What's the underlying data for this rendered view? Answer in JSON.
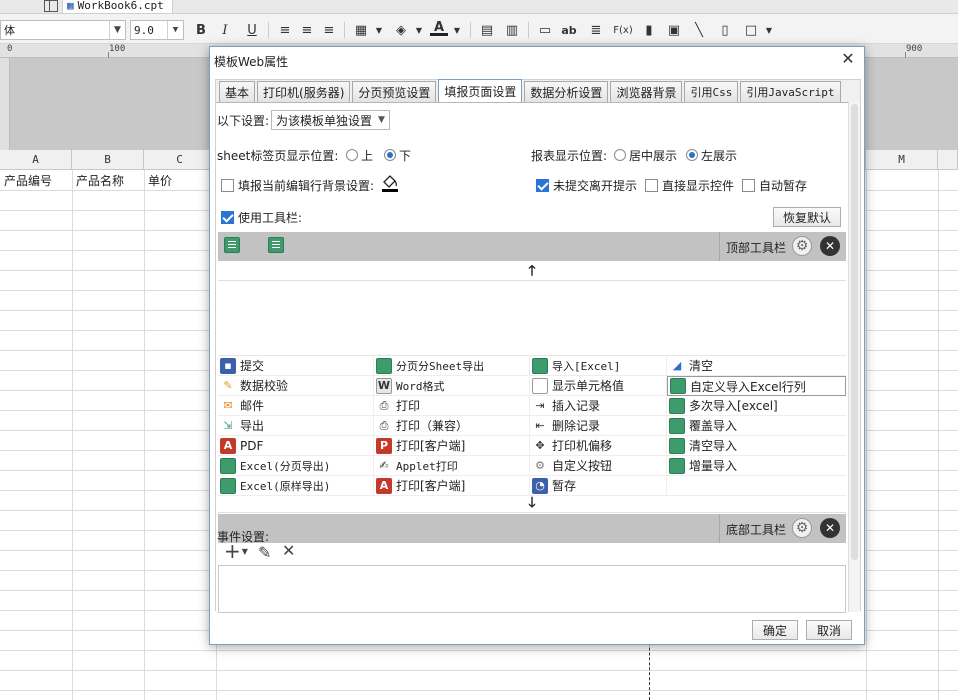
{
  "app": {
    "tab": {
      "file_name": "WorkBook6.cpt"
    },
    "toolbar": {
      "font_name": "体",
      "font_size": "9.0",
      "bold": "B",
      "italic": "I",
      "underline": "U",
      "text_icon": "ab",
      "formula_icon": "F(x)"
    },
    "ruler": {
      "marks": [
        "0",
        "100",
        "900"
      ]
    },
    "sheet": {
      "columns": [
        "A",
        "B",
        "C",
        "M"
      ],
      "header_row": [
        "产品编号",
        "产品名称",
        "单价"
      ]
    }
  },
  "dialog": {
    "title": "模板Web属性",
    "tabs": [
      {
        "label": "基本"
      },
      {
        "label": "打印机(服务器)"
      },
      {
        "label": "分页预览设置"
      },
      {
        "label": "填报页面设置"
      },
      {
        "label": "数据分析设置"
      },
      {
        "label": "浏览器背景"
      },
      {
        "label": "引用Css"
      },
      {
        "label": "引用JavaScript"
      }
    ],
    "active_tab": "填报页面设置",
    "settings": {
      "scope_label": "以下设置:",
      "scope_value": "为该模板单独设置",
      "sheet_pos_label": "sheet标签页显示位置:",
      "sheet_pos_top": "上",
      "sheet_pos_bottom": "下",
      "report_pos_label": "报表显示位置:",
      "report_pos_center": "居中展示",
      "report_pos_left": "左展示",
      "fill_bg_label": "填报当前编辑行背景设置:",
      "unsubmitted_label": "未提交离开提示",
      "direct_control_label": "直接显示控件",
      "auto_save_label": "自动暂存",
      "use_toolbar_label": "使用工具栏:",
      "restore_default": "恢复默认"
    },
    "top_toolbar_label": "顶部工具栏",
    "bottom_toolbar_label": "底部工具栏",
    "buttons": [
      [
        {
          "label": "提交",
          "icon": "save-icon"
        },
        {
          "label": "分页分Sheet导出",
          "icon": "excel-icon"
        },
        {
          "label": "导入[Excel]",
          "icon": "excel-icon"
        },
        {
          "label": "清空",
          "icon": "eraser-icon"
        }
      ],
      [
        {
          "label": "数据校验",
          "icon": "pencil-icon"
        },
        {
          "label": "Word格式",
          "icon": "word-icon"
        },
        {
          "label": "显示单元格值",
          "icon": "cell-icon"
        },
        {
          "label": "自定义导入Excel行列",
          "icon": "excel-icon"
        }
      ],
      [
        {
          "label": "邮件",
          "icon": "mail-icon"
        },
        {
          "label": "打印",
          "icon": "printer-icon"
        },
        {
          "label": "插入记录",
          "icon": "insert-row-icon"
        },
        {
          "label": "多次导入[excel]",
          "icon": "excel-icon"
        }
      ],
      [
        {
          "label": "导出",
          "icon": "export-icon"
        },
        {
          "label": "打印（兼容）",
          "icon": "printer-icon"
        },
        {
          "label": "删除记录",
          "icon": "delete-row-icon"
        },
        {
          "label": "覆盖导入",
          "icon": "excel-icon"
        }
      ],
      [
        {
          "label": "PDF",
          "icon": "pdf-icon"
        },
        {
          "label": "打印[客户端]",
          "icon": "pdf-print-icon"
        },
        {
          "label": "打印机偏移",
          "icon": "move-icon"
        },
        {
          "label": "清空导入",
          "icon": "excel-icon"
        }
      ],
      [
        {
          "label": "Excel(分页导出)",
          "icon": "excel-icon"
        },
        {
          "label": "Applet打印",
          "icon": "applet-icon"
        },
        {
          "label": "自定义按钮",
          "icon": "gear-icon"
        },
        {
          "label": "增量导入",
          "icon": "excel-icon"
        }
      ],
      [
        {
          "label": "Excel(原样导出)",
          "icon": "excel-icon"
        },
        {
          "label": "打印[客户端]",
          "icon": "pdf-icon"
        },
        {
          "label": "暂存",
          "icon": "save-clock-icon"
        },
        {
          "label": "",
          "icon": ""
        }
      ]
    ],
    "events_label": "事件设置:",
    "ok": "确定",
    "cancel": "取消"
  }
}
